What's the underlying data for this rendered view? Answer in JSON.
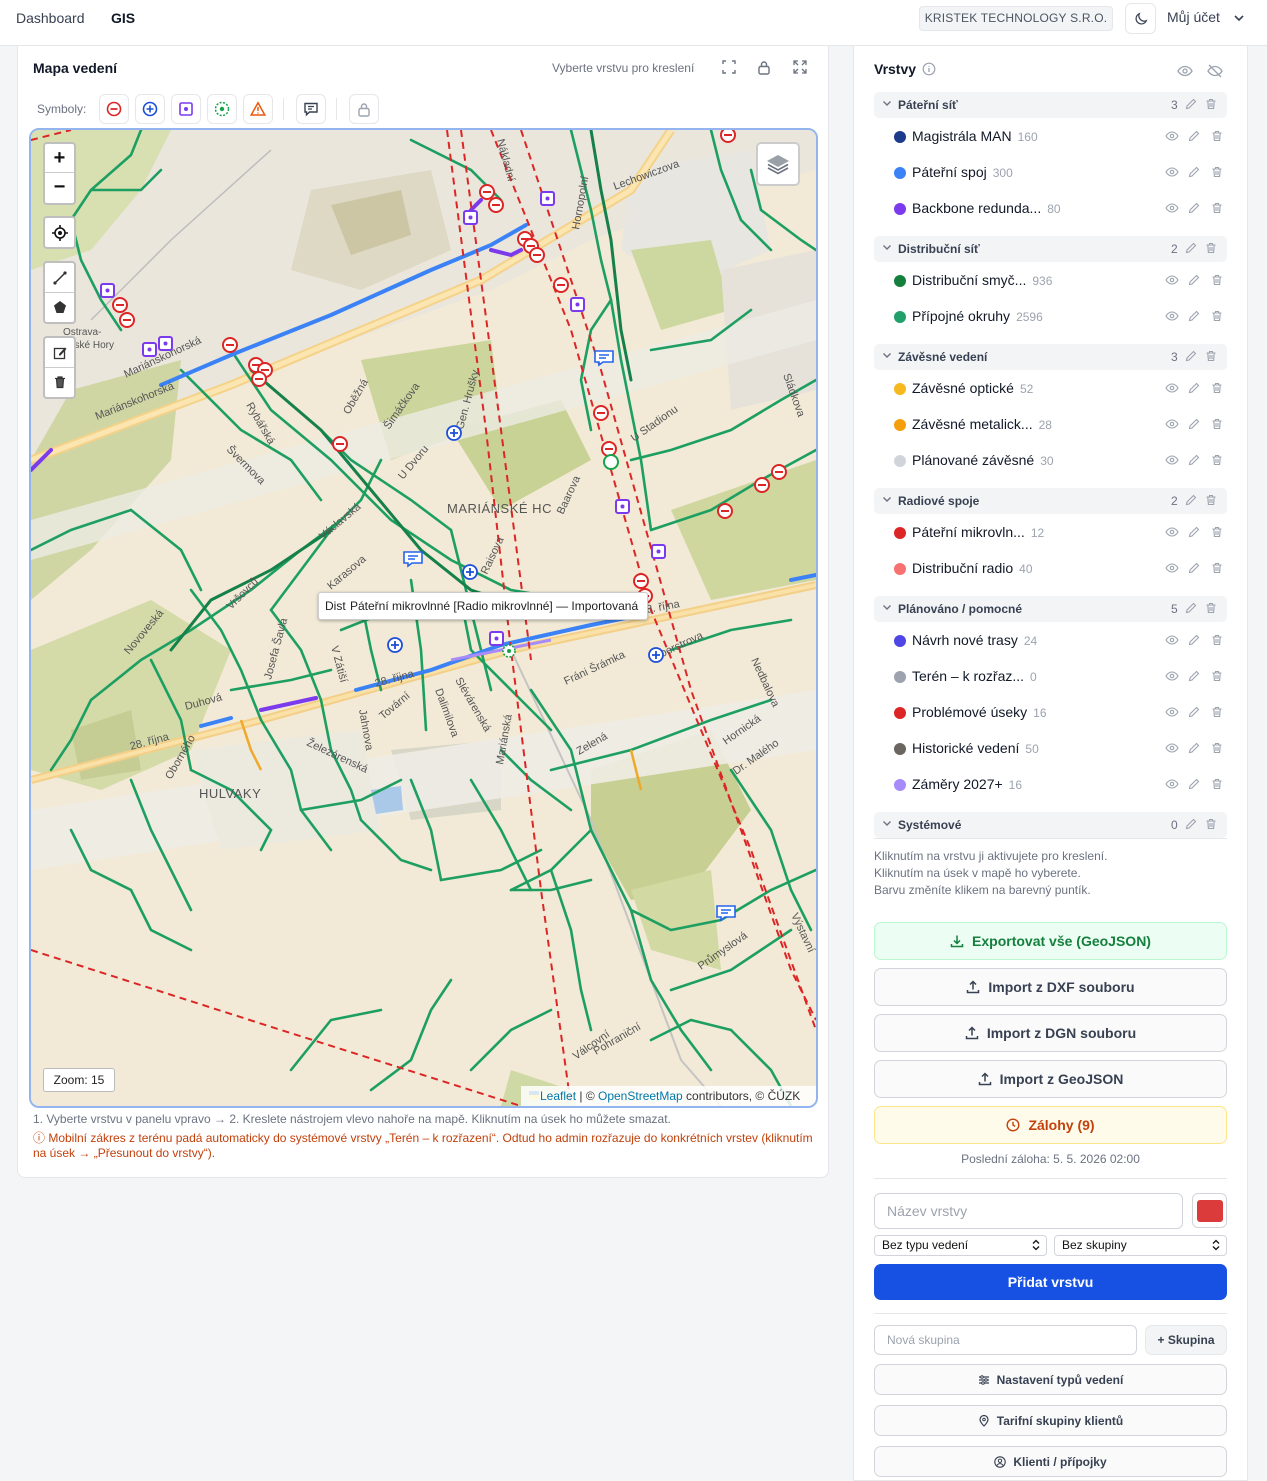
{
  "topbar": {
    "nav": [
      "Dashboard",
      "GIS"
    ],
    "company": "KRISTEK TECHNOLOGY S.R.O.",
    "account": "Můj účet"
  },
  "map": {
    "title": "Mapa vedení",
    "draw_hint": "Vyberte vrstvu pro kreslení",
    "symbols_label": "Symboly:",
    "tooltip_cut": "Dist",
    "tooltip": "Páteřní mikrovlnné [Radio mikrovlnné] — Importovaná",
    "zoom_label": "Zoom: 15",
    "attribution": {
      "leaflet": "Leaflet",
      "sep": " | © ",
      "osm": "OpenStreetMap",
      "rest": " contributors, © ČÚZK"
    },
    "place_labels": {
      "marianske": "MARIÁNSKÉ HC",
      "hulvaky": "HULVAKY",
      "ostrava": "Ostrava-",
      "ostrava2": "nské Hory",
      "lechowiczova": "Lechowiczova",
      "marianskohorska": "Mariánskohorská",
      "rijna": "28. října",
      "rybarska": "Rybářská",
      "svermova": "Švermova",
      "vrsovcu": "Vršovců",
      "novoveska": "Novoveská",
      "duhova": "Duhová",
      "obornehо": "Oborného",
      "zelezarenska": "Železárenská",
      "frani": "Fráni Šrámka",
      "foerstrova": "Foerstrova",
      "nedbalova": "Nedbalova",
      "hornicka": "Hornická",
      "zelena": "Zelená",
      "valcovni": "Válcovní",
      "pohranicni": "Pohraniční",
      "vystavni": "Výstavní",
      "sladkova": "Sládkova",
      "baarova": "Baarova",
      "u_dvoru": "U Dvoru",
      "gen_hrusky": "Gen. Hrušky",
      "karasova": "Karasova",
      "vaclavska": "Václavská",
      "raisova": "Raisova",
      "smetanova": "Šimáčkova",
      "obezna": "Oběžná",
      "u_stadionu": "U Stadionu",
      "nakladni": "Nákladní",
      "hrnecni": "Hornopolní",
      "dalimilova": "Dalimilova",
      "slevarenska": "Slévárenská",
      "marianska": "Mariánská",
      "tovarni": "Tovární",
      "v_zatisi": "V Zátiší",
      "josefa": "Josefa Šavla",
      "jahnova": "Jahnova",
      "dr_malylho": "Dr. Malého",
      "prumyslova": "Průmyslová"
    }
  },
  "instructions": "1. Vyberte vrstvu v panelu vpravo → 2. Kreslete nástrojem vlevo nahoře na mapě. Kliknutím na úsek ho můžete smazat.",
  "warning": "ⓘ Mobilní zákres z terénu padá automaticky do systémové vrstvy „Terén – k rozřazení“. Odtud ho admin rozřazuje do konkrétních vrstev (kliknutím na úsek → „Přesunout do vrstvy“).",
  "panel": {
    "title": "Vrstvy",
    "groups": [
      {
        "name": "Páteřní síť",
        "count": "3",
        "layers": [
          {
            "name": "Magistrála MAN",
            "count": "160",
            "color": "#1e3a8a"
          },
          {
            "name": "Páteřní spoj",
            "count": "300",
            "color": "#3b82f6"
          },
          {
            "name": "Backbone redunda...",
            "count": "80",
            "color": "#7c3aed"
          }
        ]
      },
      {
        "name": "Distribuční síť",
        "count": "2",
        "layers": [
          {
            "name": "Distribuční smyč...",
            "count": "936",
            "color": "#15803d"
          },
          {
            "name": "Přípojné okruhy",
            "count": "2596",
            "color": "#22a06b"
          }
        ]
      },
      {
        "name": "Závěsné vedení",
        "count": "3",
        "layers": [
          {
            "name": "Závěsné optické",
            "count": "52",
            "color": "#f5b91e"
          },
          {
            "name": "Závěsné metalick...",
            "count": "28",
            "color": "#f59e0b"
          },
          {
            "name": "Plánované závěsné",
            "count": "30",
            "color": "#d1d5db"
          }
        ]
      },
      {
        "name": "Radiové spoje",
        "count": "2",
        "layers": [
          {
            "name": "Páteřní mikrovln...",
            "count": "12",
            "color": "#dc2626"
          },
          {
            "name": "Distribuční radio",
            "count": "40",
            "color": "#f87171"
          }
        ]
      },
      {
        "name": "Plánováno / pomocné",
        "count": "5",
        "layers": [
          {
            "name": "Návrh nové trasy",
            "count": "24",
            "color": "#4f46e5"
          },
          {
            "name": "Terén – k rozřaz...",
            "count": "0",
            "color": "#9ca3af"
          },
          {
            "name": "Problémové úseky",
            "count": "16",
            "color": "#dc2626"
          },
          {
            "name": "Historické vedení",
            "count": "50",
            "color": "#6b6560"
          },
          {
            "name": "Záměry 2027+",
            "count": "16",
            "color": "#a78bfa"
          }
        ]
      },
      {
        "name": "Systémové",
        "count": "0",
        "layers": []
      }
    ],
    "hints": [
      "Kliknutím na vrstvu ji aktivujete pro kreslení.",
      "Kliknutím na úsek v mapě ho vyberete.",
      "Barvu změníte klikem na barevný puntík."
    ],
    "export_label": "Exportovat vše (GeoJSON)",
    "import_dxf": "Import z DXF souboru",
    "import_dgn": "Import z DGN souboru",
    "import_geojson": "Import z GeoJSON",
    "backups": "Zálohy (9)",
    "last_backup": "Poslední záloha: 5. 5. 2026 02:00",
    "layer_name_placeholder": "Název vrstvy",
    "type_select": "Bez typu vedení",
    "group_select": "Bez skupiny",
    "add_layer": "Přidat vrstvu",
    "new_group_placeholder": "Nová skupina",
    "add_group": "+ Skupina",
    "settings_types": "Nastavení typů vedení",
    "tariff_groups": "Tarifní skupiny klientů",
    "clients": "Klienti / přípojky",
    "new_color": "#dc3b3b"
  }
}
